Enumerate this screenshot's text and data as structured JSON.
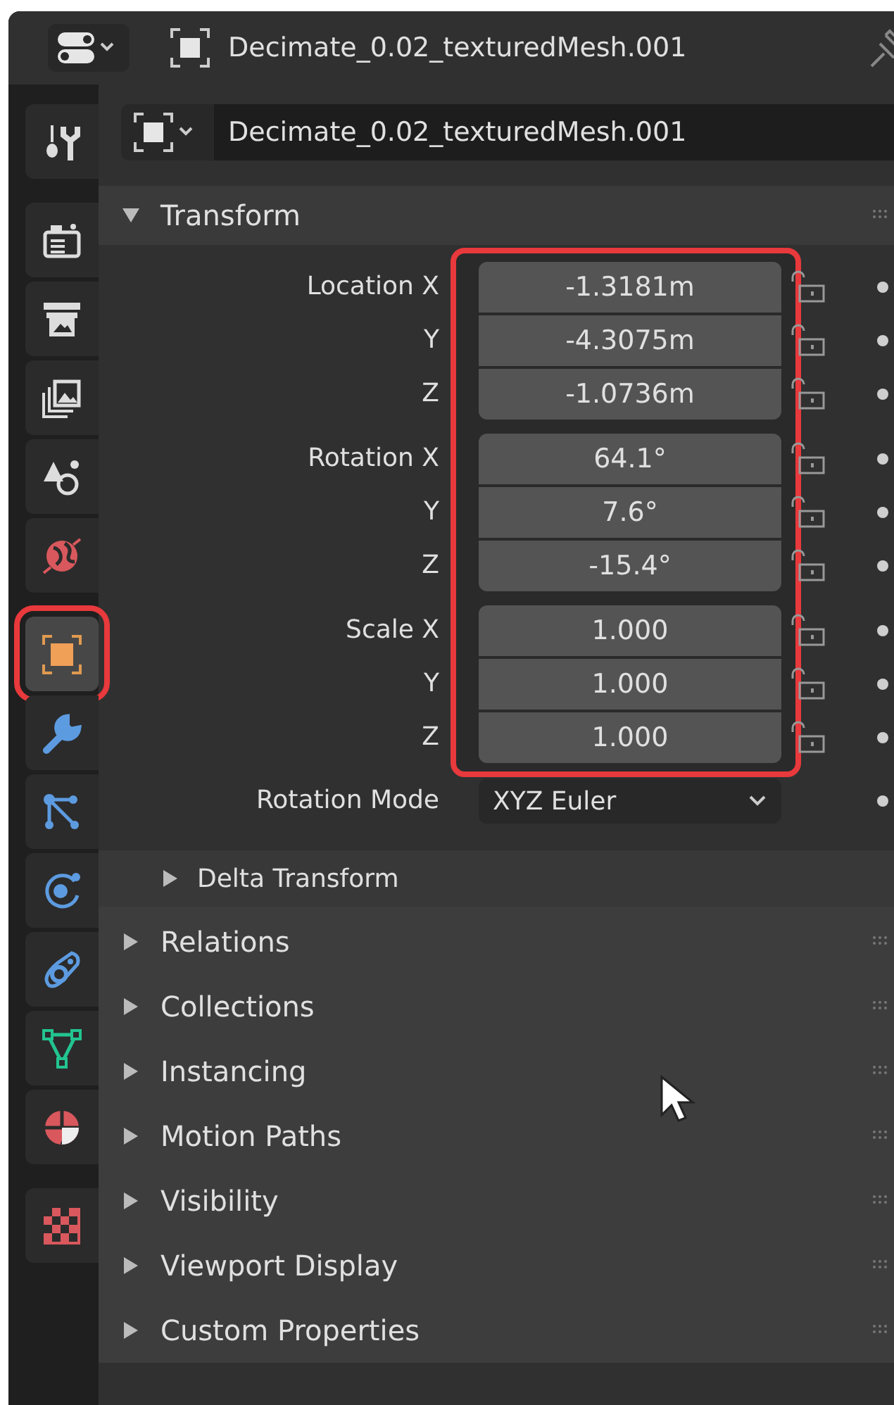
{
  "header": {
    "object_name": "Decimate_0.02_texturedMesh.001"
  },
  "sidebar": {
    "groups": [
      {
        "tabs": [
          {
            "kind": "tool",
            "selected": false,
            "highlighted": false
          }
        ]
      },
      {
        "tabs": [
          {
            "kind": "render",
            "selected": false,
            "highlighted": false
          },
          {
            "kind": "output",
            "selected": false,
            "highlighted": false
          },
          {
            "kind": "view_layer",
            "selected": false,
            "highlighted": false
          },
          {
            "kind": "scene",
            "selected": false,
            "highlighted": false
          },
          {
            "kind": "world",
            "selected": false,
            "highlighted": false
          }
        ]
      },
      {
        "tabs": [
          {
            "kind": "object",
            "selected": true,
            "highlighted": true
          },
          {
            "kind": "modifiers",
            "selected": false,
            "highlighted": false
          },
          {
            "kind": "particles",
            "selected": false,
            "highlighted": false
          },
          {
            "kind": "physics",
            "selected": false,
            "highlighted": false
          },
          {
            "kind": "constraints",
            "selected": false,
            "highlighted": false
          },
          {
            "kind": "data",
            "selected": false,
            "highlighted": false
          },
          {
            "kind": "material",
            "selected": false,
            "highlighted": false
          }
        ]
      },
      {
        "tabs": [
          {
            "kind": "texture",
            "selected": false,
            "highlighted": false
          }
        ]
      }
    ]
  },
  "name_field": {
    "value": "Decimate_0.02_texturedMesh.001"
  },
  "transform": {
    "title": "Transform",
    "expanded": true,
    "highlighted": true,
    "groups": [
      {
        "rows": [
          {
            "label": "Location X",
            "value": "-1.3181m",
            "locked": false
          },
          {
            "label": "Y",
            "value": "-4.3075m",
            "locked": false
          },
          {
            "label": "Z",
            "value": "-1.0736m",
            "locked": false
          }
        ]
      },
      {
        "rows": [
          {
            "label": "Rotation X",
            "value": "64.1°",
            "locked": false
          },
          {
            "label": "Y",
            "value": "7.6°",
            "locked": false
          },
          {
            "label": "Z",
            "value": "-15.4°",
            "locked": false
          }
        ]
      },
      {
        "rows": [
          {
            "label": "Scale X",
            "value": "1.000",
            "locked": false
          },
          {
            "label": "Y",
            "value": "1.000",
            "locked": false
          },
          {
            "label": "Z",
            "value": "1.000",
            "locked": false
          }
        ]
      }
    ],
    "rotation_mode": {
      "label": "Rotation Mode",
      "value": "XYZ Euler"
    },
    "delta": {
      "title": "Delta Transform",
      "expanded": false
    }
  },
  "panels": [
    {
      "title": "Relations",
      "expanded": false
    },
    {
      "title": "Collections",
      "expanded": false
    },
    {
      "title": "Instancing",
      "expanded": false
    },
    {
      "title": "Motion Paths",
      "expanded": false
    },
    {
      "title": "Visibility",
      "expanded": false
    },
    {
      "title": "Viewport Display",
      "expanded": false
    },
    {
      "title": "Custom Properties",
      "expanded": false
    }
  ]
}
